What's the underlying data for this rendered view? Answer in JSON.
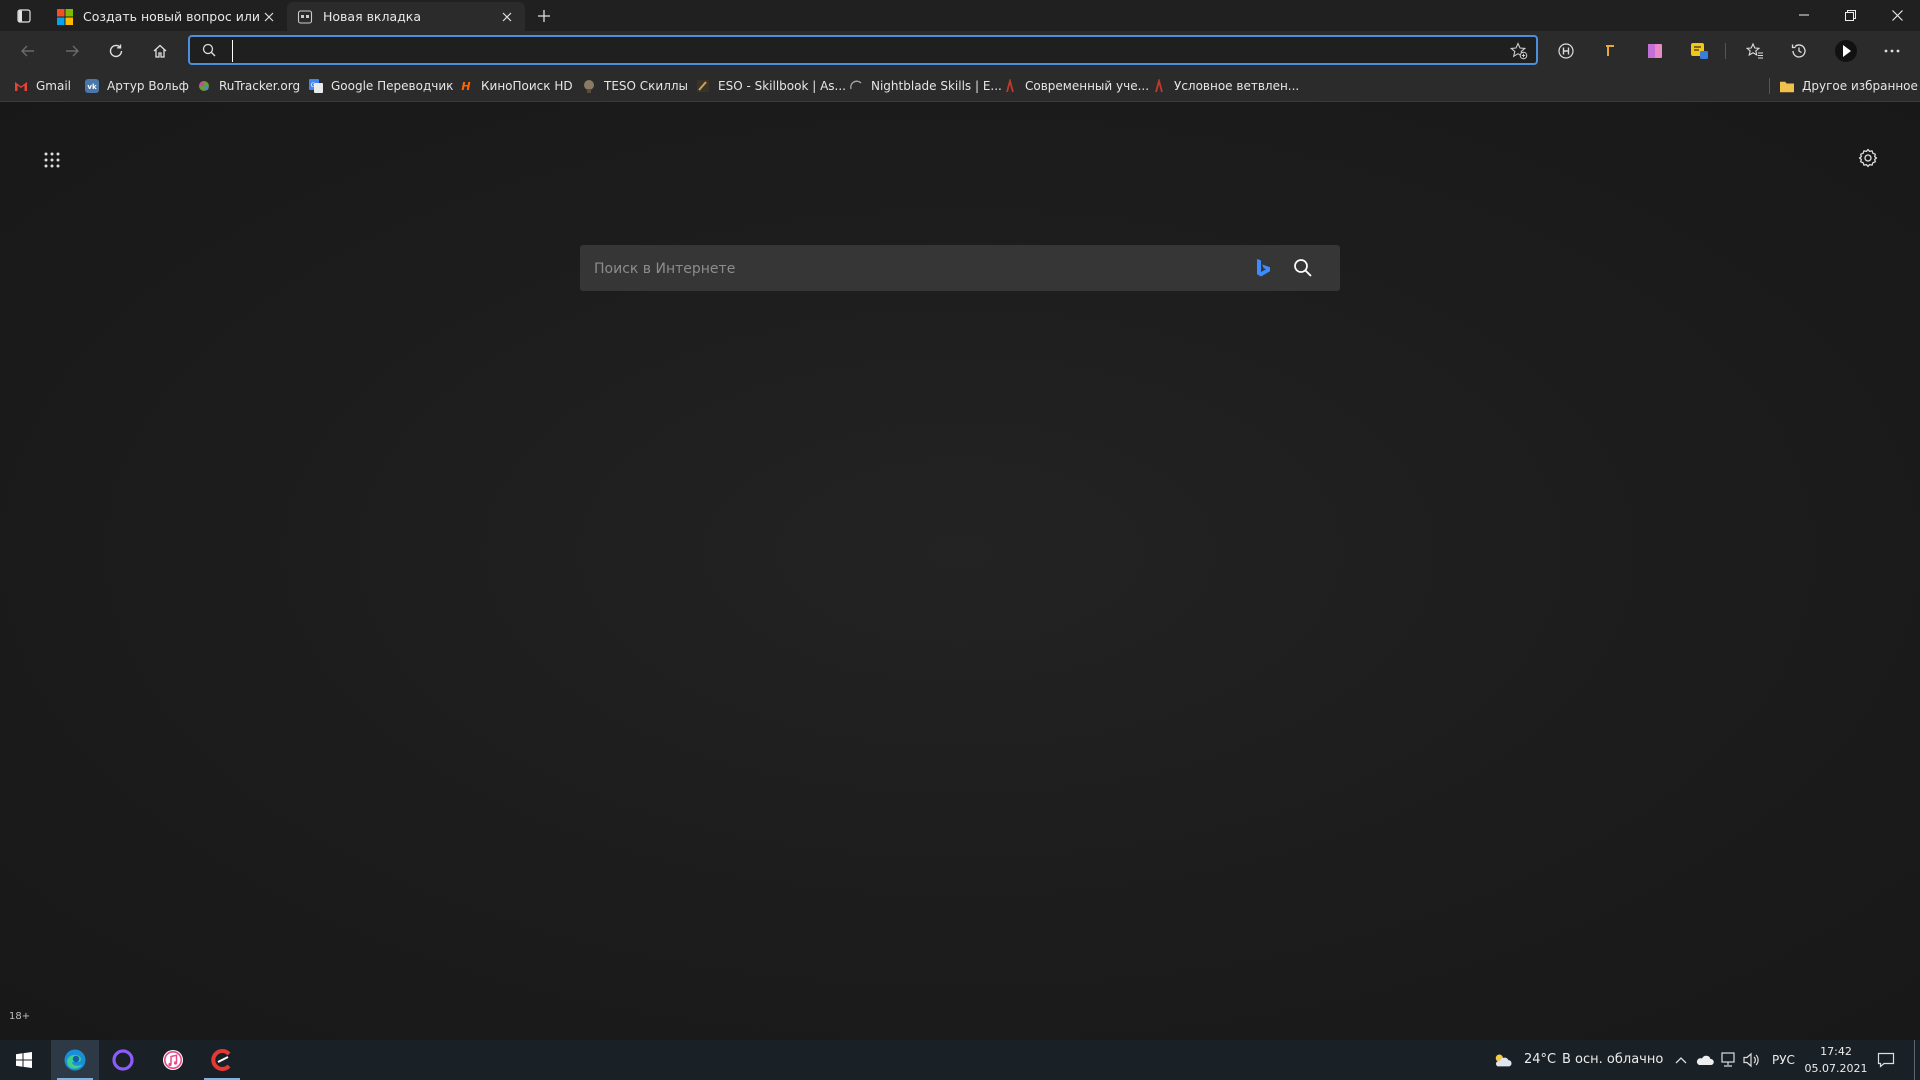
{
  "tabs": [
    {
      "title": "Создать новый вопрос или нач",
      "icon": "microsoft-logo-icon",
      "active": false
    },
    {
      "title": "Новая вкладка",
      "icon": "new-tab-page-icon",
      "active": true
    }
  ],
  "address_bar": {
    "value": "",
    "placeholder": ""
  },
  "bookmarks": [
    {
      "label": "Gmail",
      "icon": "gmail-icon"
    },
    {
      "label": "Артур Вольф",
      "icon": "vk-icon"
    },
    {
      "label": "RuTracker.org",
      "icon": "rutracker-icon"
    },
    {
      "label": "Google Переводчик",
      "icon": "google-translate-icon"
    },
    {
      "label": "КиноПоиск HD",
      "icon": "kinopoisk-icon"
    },
    {
      "label": "TESO Скиллы",
      "icon": "teso-icon"
    },
    {
      "label": "ESO - Skillbook | As...",
      "icon": "eso-skillbook-icon"
    },
    {
      "label": "Nightblade Skills | E...",
      "icon": "nightblade-icon"
    },
    {
      "label": "Современный уче...",
      "icon": "javascript-info-icon"
    },
    {
      "label": "Условное ветвлен...",
      "icon": "javascript-info-icon"
    }
  ],
  "other_favorites": "Другое избранное",
  "search": {
    "placeholder": "Поиск в Интернете"
  },
  "age_rating": "18+",
  "taskbar": {
    "weather_temp": "24°C",
    "weather_desc": "В осн. облачно",
    "language": "РУС",
    "time": "17:42",
    "date": "05.07.2021"
  },
  "colors": {
    "accent": "#4d8fdc",
    "page_bg": "#1b1b1b",
    "taskbar_bg": "#1a2126"
  }
}
